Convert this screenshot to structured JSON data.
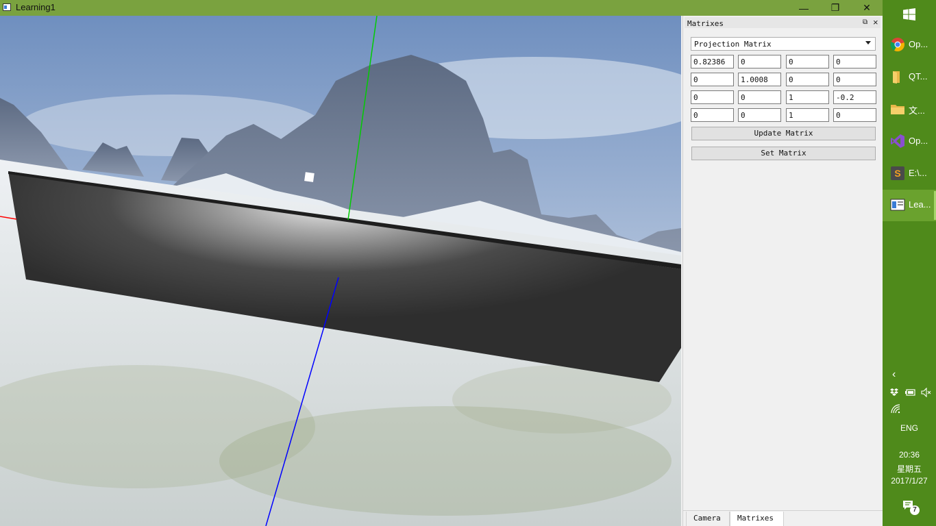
{
  "window": {
    "title": "Learning1",
    "controls": {
      "minimize": "—",
      "maximize": "❐",
      "close": "✕"
    }
  },
  "dock": {
    "title": "Matrixes",
    "selected_matrix": "Projection Matrix",
    "matrix": [
      [
        "0.82386",
        "0",
        "0",
        "0"
      ],
      [
        "0",
        "1.0008",
        "0",
        "0"
      ],
      [
        "0",
        "0",
        "1",
        "-0.2"
      ],
      [
        "0",
        "0",
        "1",
        "0"
      ]
    ],
    "update_label": "Update Matrix",
    "set_label": "Set Matrix",
    "tabs": [
      {
        "label": "Camera",
        "active": false
      },
      {
        "label": "Matrixes",
        "active": true
      }
    ]
  },
  "taskbar": {
    "items": [
      {
        "label": "Op...",
        "icon": "chrome-icon",
        "active": false
      },
      {
        "label": "QT...",
        "icon": "folder-icon",
        "active": false
      },
      {
        "label": "文...",
        "icon": "folder-icon",
        "active": false
      },
      {
        "label": "Op...",
        "icon": "visual-studio-icon",
        "active": false
      },
      {
        "label": "E:\\...",
        "icon": "sublime-text-icon",
        "active": false
      },
      {
        "label": "Lea...",
        "icon": "app-window-icon",
        "active": true
      }
    ],
    "tray": {
      "language": "ENG",
      "time": "20:36",
      "day": "星期五",
      "date": "2017/1/27",
      "notifications": "7"
    }
  },
  "colors": {
    "titlebar": "#7aa23f",
    "taskbar": "#4f8a1b",
    "taskbar_active": "#6aa22e",
    "axis_x": "#ff0000",
    "axis_y": "#00cc00",
    "axis_z": "#0000ff"
  }
}
